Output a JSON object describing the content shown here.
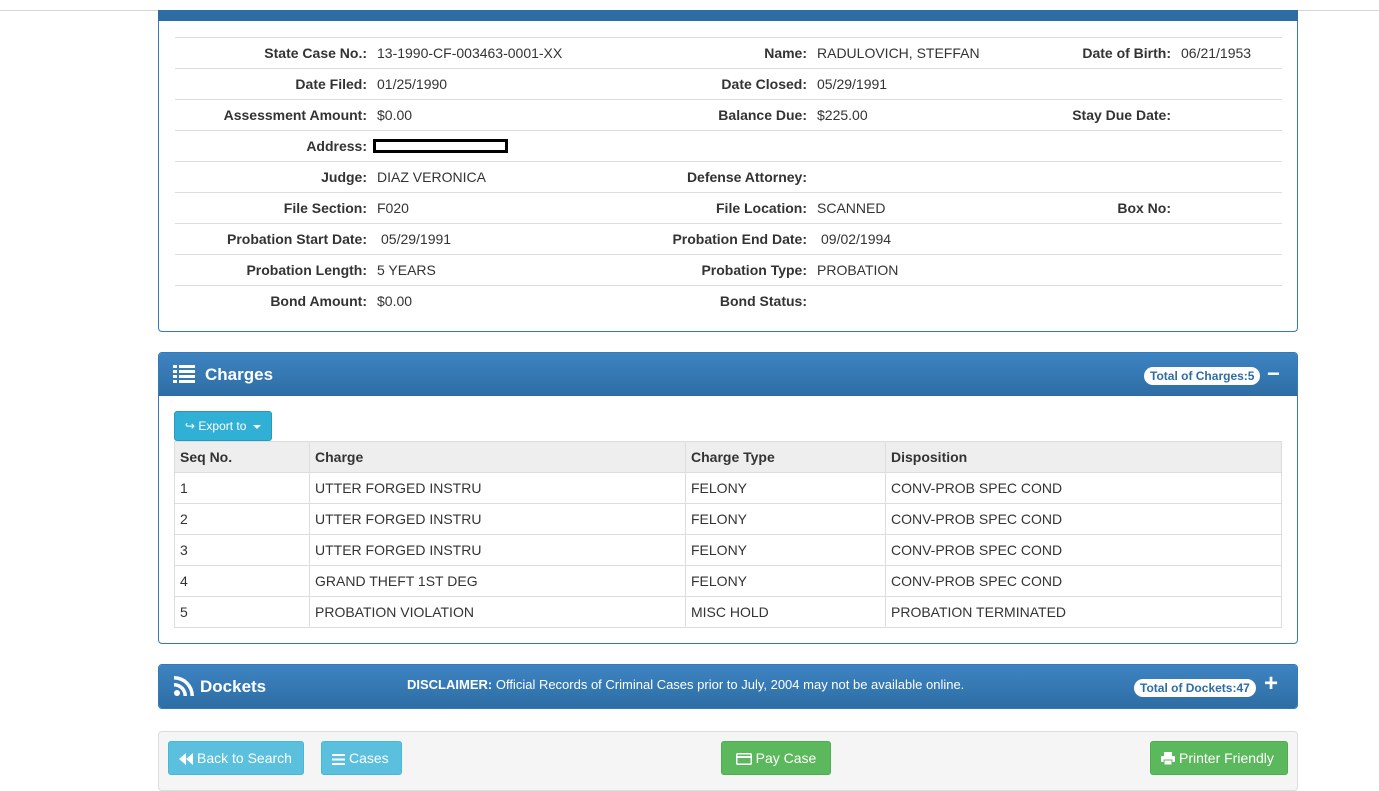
{
  "details": {
    "rows": [
      [
        {
          "label": "State Case No.:",
          "value": "13-1990-CF-003463-0001-XX"
        },
        {
          "label": "Name:",
          "value": "RADULOVICH, STEFFAN"
        },
        {
          "label": "Date of Birth:",
          "value": "06/21/1953"
        }
      ],
      [
        {
          "label": "Date Filed:",
          "value": "01/25/1990"
        },
        {
          "label": "Date Closed:",
          "value": "05/29/1991"
        }
      ],
      [
        {
          "label": "Assessment Amount:",
          "value": "$0.00"
        },
        {
          "label": "Balance Due:",
          "value": "$225.00"
        },
        {
          "label": "Stay Due Date:",
          "value": ""
        }
      ],
      [
        {
          "label": "Address:",
          "value": ""
        }
      ],
      [
        {
          "label": "Judge:",
          "value": "DIAZ VERONICA"
        },
        {
          "label": "Defense Attorney:",
          "value": ""
        }
      ],
      [
        {
          "label": "File Section:",
          "value": "F020"
        },
        {
          "label": "File Location:",
          "value": "SCANNED"
        },
        {
          "label": "Box No:",
          "value": ""
        }
      ],
      [
        {
          "label": "Probation Start Date:",
          "value": "05/29/1991"
        },
        {
          "label": "Probation End Date:",
          "value": "09/02/1994"
        }
      ],
      [
        {
          "label": "Probation Length:",
          "value": "5 YEARS"
        },
        {
          "label": "Probation Type:",
          "value": "PROBATION"
        }
      ],
      [
        {
          "label": "Bond Amount:",
          "value": "$0.00"
        },
        {
          "label": "Bond Status:",
          "value": ""
        }
      ]
    ]
  },
  "charges": {
    "title": "Charges",
    "total_badge": "Total of Charges:5",
    "toggle": "−",
    "export_label": "Export to",
    "columns": [
      "Seq No.",
      "Charge",
      "Charge Type",
      "Disposition"
    ],
    "rows": [
      [
        "1",
        "UTTER FORGED INSTRU",
        "FELONY",
        "CONV-PROB SPEC COND"
      ],
      [
        "2",
        "UTTER FORGED INSTRU",
        "FELONY",
        "CONV-PROB SPEC COND"
      ],
      [
        "3",
        "UTTER FORGED INSTRU",
        "FELONY",
        "CONV-PROB SPEC COND"
      ],
      [
        "4",
        "GRAND THEFT 1ST DEG",
        "FELONY",
        "CONV-PROB SPEC COND"
      ],
      [
        "5",
        "PROBATION VIOLATION",
        "MISC HOLD",
        "PROBATION TERMINATED"
      ]
    ]
  },
  "dockets": {
    "title": "Dockets",
    "disclaimer_label": "DISCLAIMER:",
    "disclaimer_text": " Official Records of Criminal Cases prior to July, 2004 may not be available online.",
    "total_badge": "Total of Dockets:47",
    "toggle": "+"
  },
  "actions": {
    "back": "Back to Search",
    "cases": "Cases",
    "pay": "Pay Case",
    "print": "Printer Friendly"
  },
  "colors": {
    "primary": "#337ab7",
    "info": "#5bc0de",
    "success": "#5cb85c"
  },
  "icons": {
    "charges": "list-icon",
    "dockets": "rss-icon",
    "export": "export-icon",
    "back": "backward-icon",
    "cases": "bars-icon",
    "pay": "credit-card-icon",
    "print": "print-icon"
  }
}
